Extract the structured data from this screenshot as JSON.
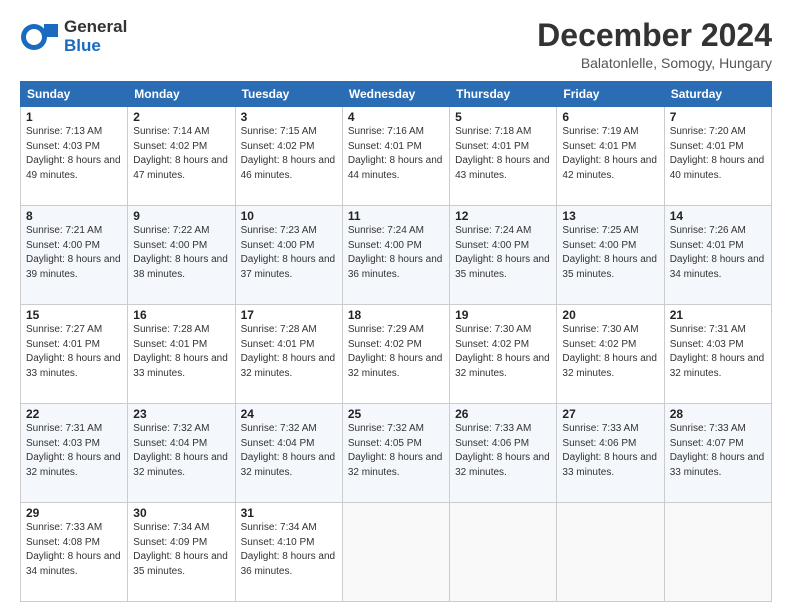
{
  "header": {
    "logo_general": "General",
    "logo_blue": "Blue",
    "month_title": "December 2024",
    "location": "Balatonlelle, Somogy, Hungary"
  },
  "days_of_week": [
    "Sunday",
    "Monday",
    "Tuesday",
    "Wednesday",
    "Thursday",
    "Friday",
    "Saturday"
  ],
  "weeks": [
    [
      {
        "day": "1",
        "sunrise": "Sunrise: 7:13 AM",
        "sunset": "Sunset: 4:03 PM",
        "daylight": "Daylight: 8 hours and 49 minutes."
      },
      {
        "day": "2",
        "sunrise": "Sunrise: 7:14 AM",
        "sunset": "Sunset: 4:02 PM",
        "daylight": "Daylight: 8 hours and 47 minutes."
      },
      {
        "day": "3",
        "sunrise": "Sunrise: 7:15 AM",
        "sunset": "Sunset: 4:02 PM",
        "daylight": "Daylight: 8 hours and 46 minutes."
      },
      {
        "day": "4",
        "sunrise": "Sunrise: 7:16 AM",
        "sunset": "Sunset: 4:01 PM",
        "daylight": "Daylight: 8 hours and 44 minutes."
      },
      {
        "day": "5",
        "sunrise": "Sunrise: 7:18 AM",
        "sunset": "Sunset: 4:01 PM",
        "daylight": "Daylight: 8 hours and 43 minutes."
      },
      {
        "day": "6",
        "sunrise": "Sunrise: 7:19 AM",
        "sunset": "Sunset: 4:01 PM",
        "daylight": "Daylight: 8 hours and 42 minutes."
      },
      {
        "day": "7",
        "sunrise": "Sunrise: 7:20 AM",
        "sunset": "Sunset: 4:01 PM",
        "daylight": "Daylight: 8 hours and 40 minutes."
      }
    ],
    [
      {
        "day": "8",
        "sunrise": "Sunrise: 7:21 AM",
        "sunset": "Sunset: 4:00 PM",
        "daylight": "Daylight: 8 hours and 39 minutes."
      },
      {
        "day": "9",
        "sunrise": "Sunrise: 7:22 AM",
        "sunset": "Sunset: 4:00 PM",
        "daylight": "Daylight: 8 hours and 38 minutes."
      },
      {
        "day": "10",
        "sunrise": "Sunrise: 7:23 AM",
        "sunset": "Sunset: 4:00 PM",
        "daylight": "Daylight: 8 hours and 37 minutes."
      },
      {
        "day": "11",
        "sunrise": "Sunrise: 7:24 AM",
        "sunset": "Sunset: 4:00 PM",
        "daylight": "Daylight: 8 hours and 36 minutes."
      },
      {
        "day": "12",
        "sunrise": "Sunrise: 7:24 AM",
        "sunset": "Sunset: 4:00 PM",
        "daylight": "Daylight: 8 hours and 35 minutes."
      },
      {
        "day": "13",
        "sunrise": "Sunrise: 7:25 AM",
        "sunset": "Sunset: 4:00 PM",
        "daylight": "Daylight: 8 hours and 35 minutes."
      },
      {
        "day": "14",
        "sunrise": "Sunrise: 7:26 AM",
        "sunset": "Sunset: 4:01 PM",
        "daylight": "Daylight: 8 hours and 34 minutes."
      }
    ],
    [
      {
        "day": "15",
        "sunrise": "Sunrise: 7:27 AM",
        "sunset": "Sunset: 4:01 PM",
        "daylight": "Daylight: 8 hours and 33 minutes."
      },
      {
        "day": "16",
        "sunrise": "Sunrise: 7:28 AM",
        "sunset": "Sunset: 4:01 PM",
        "daylight": "Daylight: 8 hours and 33 minutes."
      },
      {
        "day": "17",
        "sunrise": "Sunrise: 7:28 AM",
        "sunset": "Sunset: 4:01 PM",
        "daylight": "Daylight: 8 hours and 32 minutes."
      },
      {
        "day": "18",
        "sunrise": "Sunrise: 7:29 AM",
        "sunset": "Sunset: 4:02 PM",
        "daylight": "Daylight: 8 hours and 32 minutes."
      },
      {
        "day": "19",
        "sunrise": "Sunrise: 7:30 AM",
        "sunset": "Sunset: 4:02 PM",
        "daylight": "Daylight: 8 hours and 32 minutes."
      },
      {
        "day": "20",
        "sunrise": "Sunrise: 7:30 AM",
        "sunset": "Sunset: 4:02 PM",
        "daylight": "Daylight: 8 hours and 32 minutes."
      },
      {
        "day": "21",
        "sunrise": "Sunrise: 7:31 AM",
        "sunset": "Sunset: 4:03 PM",
        "daylight": "Daylight: 8 hours and 32 minutes."
      }
    ],
    [
      {
        "day": "22",
        "sunrise": "Sunrise: 7:31 AM",
        "sunset": "Sunset: 4:03 PM",
        "daylight": "Daylight: 8 hours and 32 minutes."
      },
      {
        "day": "23",
        "sunrise": "Sunrise: 7:32 AM",
        "sunset": "Sunset: 4:04 PM",
        "daylight": "Daylight: 8 hours and 32 minutes."
      },
      {
        "day": "24",
        "sunrise": "Sunrise: 7:32 AM",
        "sunset": "Sunset: 4:04 PM",
        "daylight": "Daylight: 8 hours and 32 minutes."
      },
      {
        "day": "25",
        "sunrise": "Sunrise: 7:32 AM",
        "sunset": "Sunset: 4:05 PM",
        "daylight": "Daylight: 8 hours and 32 minutes."
      },
      {
        "day": "26",
        "sunrise": "Sunrise: 7:33 AM",
        "sunset": "Sunset: 4:06 PM",
        "daylight": "Daylight: 8 hours and 32 minutes."
      },
      {
        "day": "27",
        "sunrise": "Sunrise: 7:33 AM",
        "sunset": "Sunset: 4:06 PM",
        "daylight": "Daylight: 8 hours and 33 minutes."
      },
      {
        "day": "28",
        "sunrise": "Sunrise: 7:33 AM",
        "sunset": "Sunset: 4:07 PM",
        "daylight": "Daylight: 8 hours and 33 minutes."
      }
    ],
    [
      {
        "day": "29",
        "sunrise": "Sunrise: 7:33 AM",
        "sunset": "Sunset: 4:08 PM",
        "daylight": "Daylight: 8 hours and 34 minutes."
      },
      {
        "day": "30",
        "sunrise": "Sunrise: 7:34 AM",
        "sunset": "Sunset: 4:09 PM",
        "daylight": "Daylight: 8 hours and 35 minutes."
      },
      {
        "day": "31",
        "sunrise": "Sunrise: 7:34 AM",
        "sunset": "Sunset: 4:10 PM",
        "daylight": "Daylight: 8 hours and 36 minutes."
      },
      {
        "day": "",
        "sunrise": "",
        "sunset": "",
        "daylight": ""
      },
      {
        "day": "",
        "sunrise": "",
        "sunset": "",
        "daylight": ""
      },
      {
        "day": "",
        "sunrise": "",
        "sunset": "",
        "daylight": ""
      },
      {
        "day": "",
        "sunrise": "",
        "sunset": "",
        "daylight": ""
      }
    ]
  ]
}
